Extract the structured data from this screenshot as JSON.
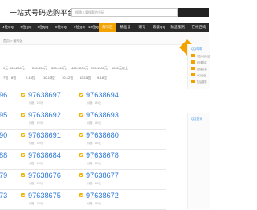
{
  "header": {
    "title": "一站式号码选购平台",
    "search_placeholder": "搜输入要搜索的号码"
  },
  "nav": {
    "items": [
      {
        "label": "4位QQ"
      },
      {
        "label": "5位QQ"
      },
      {
        "label": "6位QQ"
      },
      {
        "label": "8位QQ"
      },
      {
        "label": "9位QQ"
      },
      {
        "label": "10位QQ"
      },
      {
        "label": "靓号区"
      },
      {
        "label": "精品号"
      },
      {
        "label": "赠号"
      },
      {
        "label": "等级QQ"
      },
      {
        "label": "防盗服务"
      },
      {
        "label": "在线咨询"
      }
    ],
    "active_index": 6,
    "active_color": "#f2a300"
  },
  "breadcrumb": "首页 > 靓号区",
  "filters": {
    "price_row": [
      "0元",
      "100-200元",
      "200-300元",
      "300-400元",
      "400-1000元",
      "500-1000元",
      "1000元以上"
    ],
    "length_row": [
      "7位",
      "8位",
      "9-10位",
      "10-11位",
      "10-12位",
      "12-15位",
      "9-18位"
    ]
  },
  "numbers": [
    {
      "left": "96",
      "right": "97638697",
      "far": "97638694"
    },
    {
      "left": "95",
      "right": "97638692",
      "far": "97638693"
    },
    {
      "left": "90",
      "right": "97638691",
      "far": "97638680"
    },
    {
      "left": "88",
      "right": "97638684",
      "far": "97638678"
    },
    {
      "left": "79",
      "right": "97638676",
      "far": "97638677"
    },
    {
      "left": "73",
      "right": "97638675",
      "far": "97638672"
    }
  ],
  "number_sub": "价格：190元",
  "sidebar": {
    "heading": "QQ帮助",
    "items": [
      "9位QQ认证",
      "在线购买",
      "担保交易",
      "QQ安全",
      "售后服务"
    ],
    "heading2": "QQ资讯"
  },
  "colors": {
    "accent": "#f2a300",
    "link": "#2f7ad7"
  }
}
